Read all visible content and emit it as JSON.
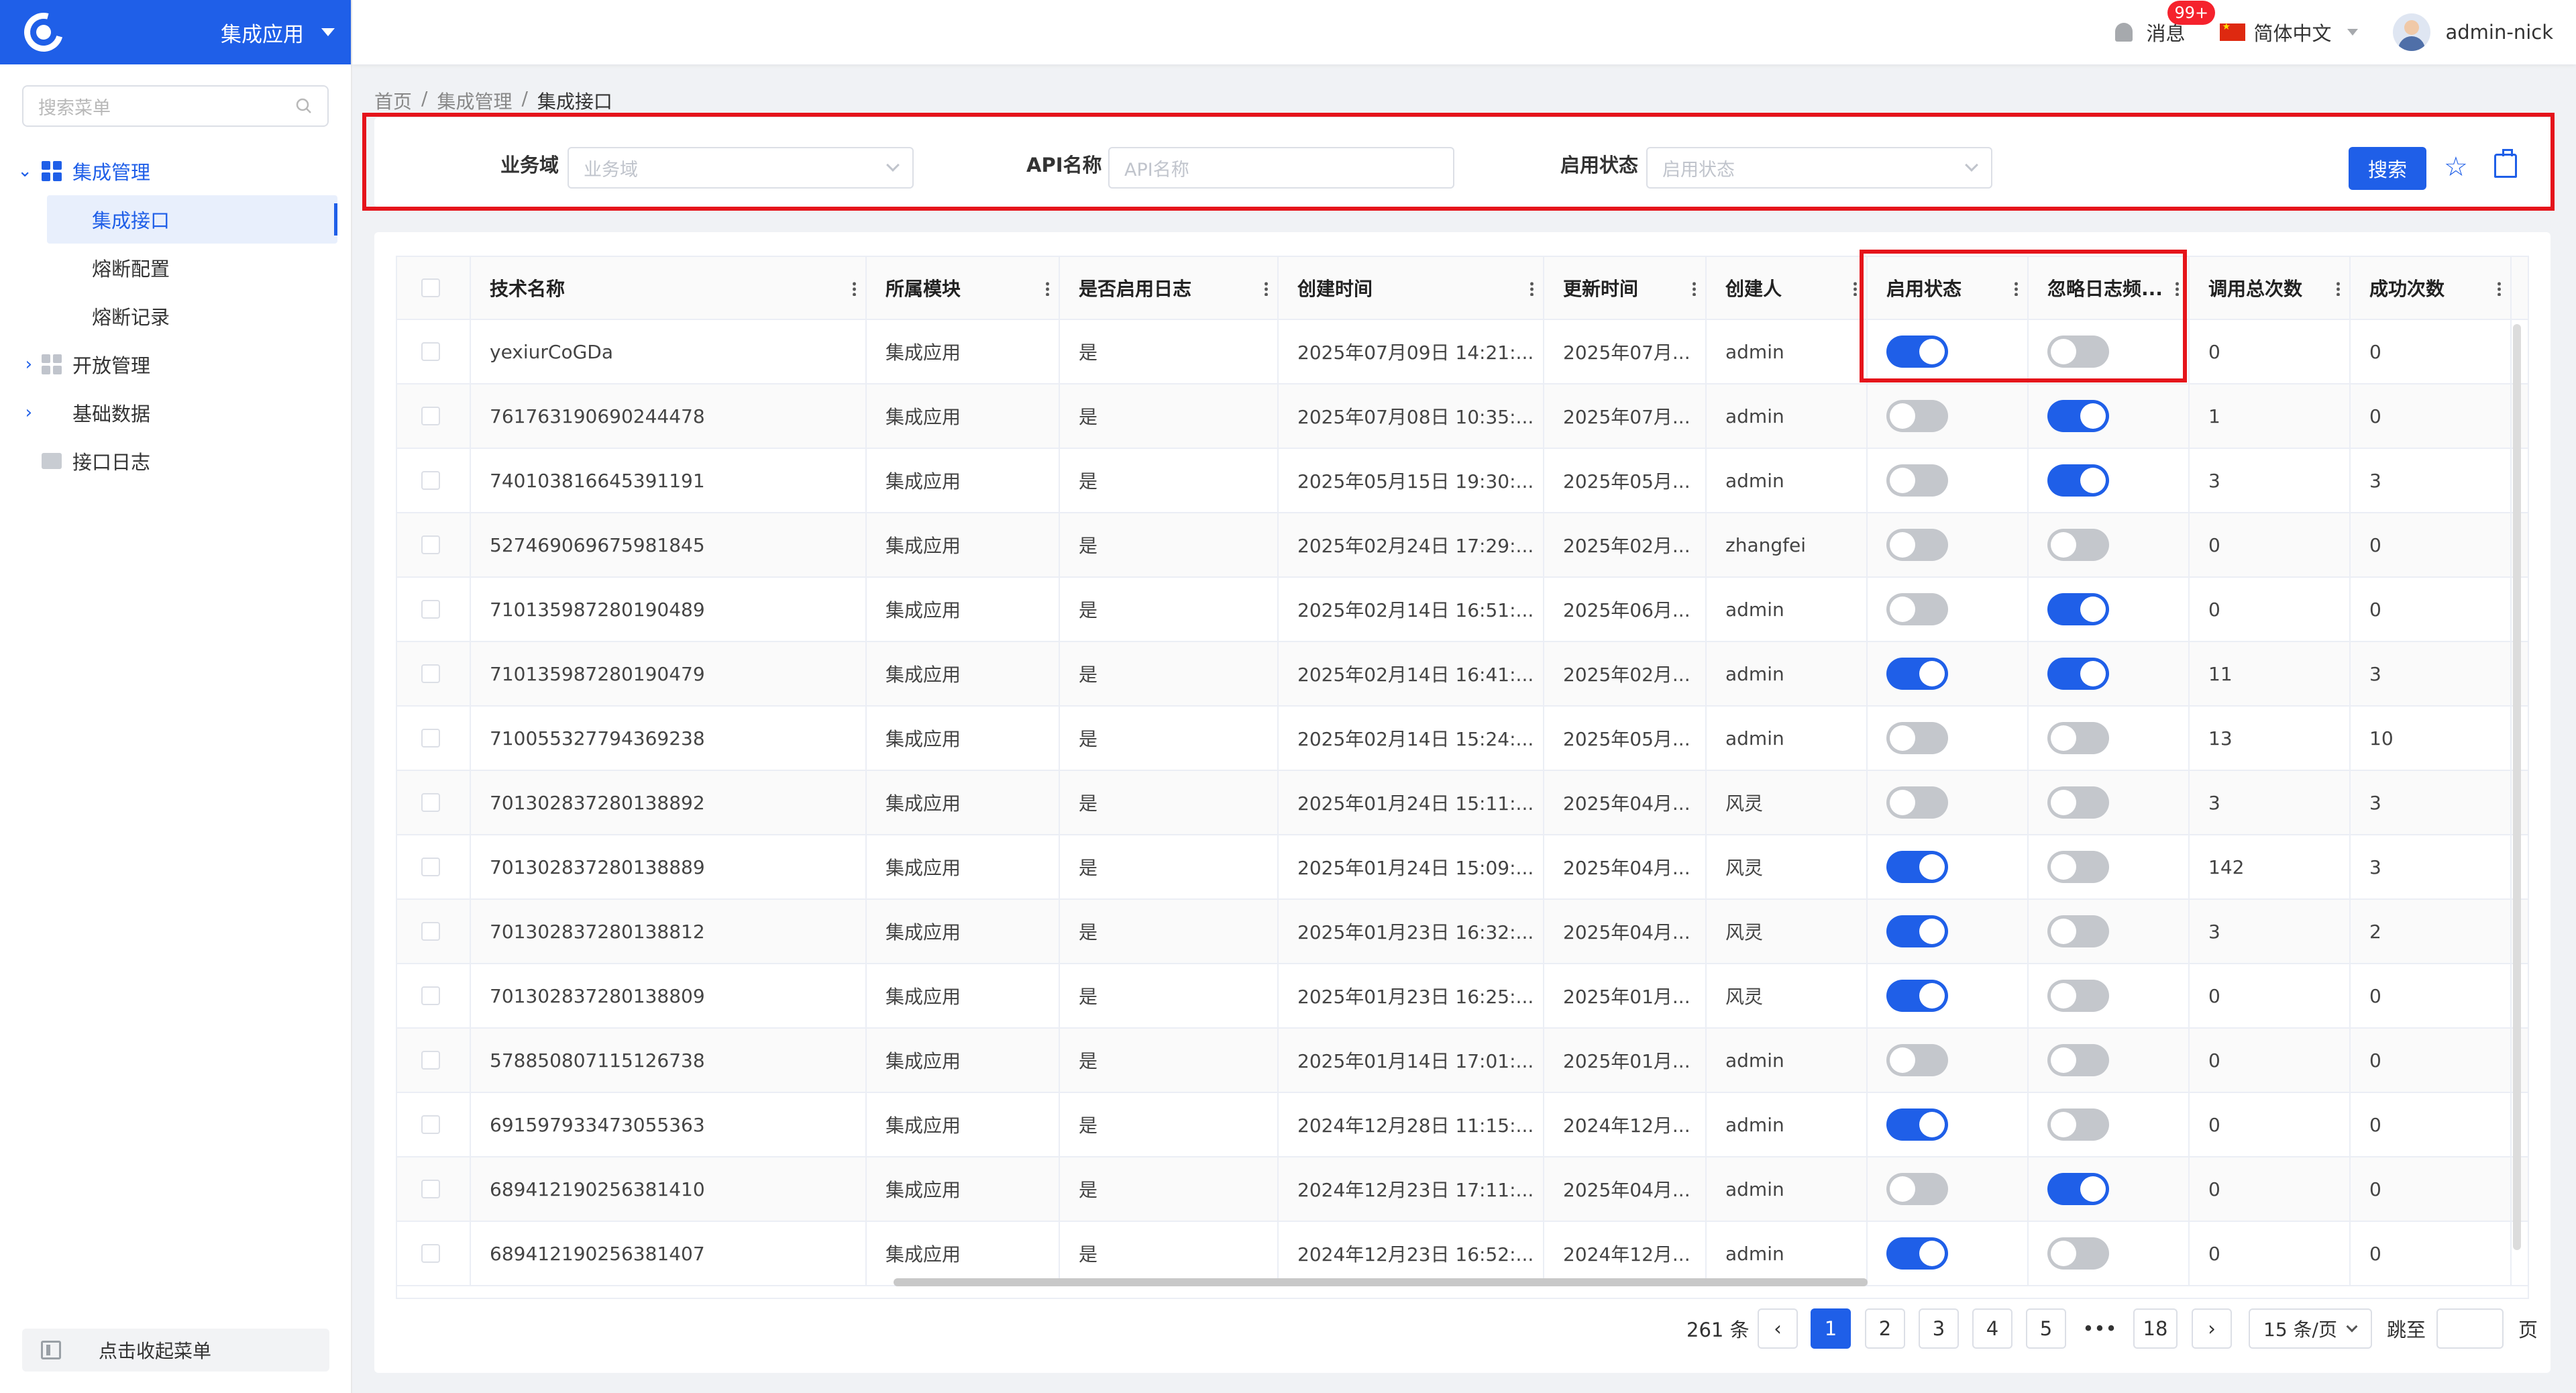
{
  "app": {
    "title": "集成应用"
  },
  "sidebar": {
    "search_placeholder": "搜索菜单",
    "items": [
      {
        "label": "集成管理",
        "expanded": true
      },
      {
        "label": "集成接口",
        "active": true
      },
      {
        "label": "熔断配置"
      },
      {
        "label": "熔断记录"
      },
      {
        "label": "开放管理",
        "expanded": false
      },
      {
        "label": "基础数据",
        "expanded": false
      },
      {
        "label": "接口日志"
      }
    ],
    "collapse_label": "点击收起菜单"
  },
  "header": {
    "notifications_label": "消息",
    "notifications_badge": "99+",
    "language": "简体中文",
    "username": "admin-nick"
  },
  "breadcrumb": [
    "首页",
    "集成管理",
    "集成接口"
  ],
  "filters": {
    "domain_label": "业务域",
    "domain_placeholder": "业务域",
    "api_label": "API名称",
    "api_placeholder": "API名称",
    "status_label": "启用状态",
    "status_placeholder": "启用状态",
    "search_button": "搜索"
  },
  "table": {
    "columns": [
      "技术名称",
      "所属模块",
      "是否启用日志",
      "创建时间",
      "更新时间",
      "创建人",
      "启用状态",
      "忽略日志频...",
      "调用总次数",
      "成功次数"
    ],
    "rows": [
      {
        "name": "yexiurCoGDa",
        "module": "集成应用",
        "log": "是",
        "created": "2025年07月09日 14:21:...",
        "updated": "2025年07月...",
        "creator": "admin",
        "enabled": true,
        "ignore_log": false,
        "calls": "0",
        "success": "0"
      },
      {
        "name": "761763190690244478",
        "module": "集成应用",
        "log": "是",
        "created": "2025年07月08日 10:35:...",
        "updated": "2025年07月...",
        "creator": "admin",
        "enabled": false,
        "ignore_log": true,
        "calls": "1",
        "success": "0"
      },
      {
        "name": "740103816645391191",
        "module": "集成应用",
        "log": "是",
        "created": "2025年05月15日 19:30:...",
        "updated": "2025年05月...",
        "creator": "admin",
        "enabled": false,
        "ignore_log": true,
        "calls": "3",
        "success": "3"
      },
      {
        "name": "527469069675981845",
        "module": "集成应用",
        "log": "是",
        "created": "2025年02月24日 17:29:...",
        "updated": "2025年02月...",
        "creator": "zhangfei",
        "enabled": false,
        "ignore_log": false,
        "calls": "0",
        "success": "0"
      },
      {
        "name": "710135987280190489",
        "module": "集成应用",
        "log": "是",
        "created": "2025年02月14日 16:51:...",
        "updated": "2025年06月...",
        "creator": "admin",
        "enabled": false,
        "ignore_log": true,
        "calls": "0",
        "success": "0"
      },
      {
        "name": "710135987280190479",
        "module": "集成应用",
        "log": "是",
        "created": "2025年02月14日 16:41:...",
        "updated": "2025年02月...",
        "creator": "admin",
        "enabled": true,
        "ignore_log": true,
        "calls": "11",
        "success": "3"
      },
      {
        "name": "710055327794369238",
        "module": "集成应用",
        "log": "是",
        "created": "2025年02月14日 15:24:...",
        "updated": "2025年05月...",
        "creator": "admin",
        "enabled": false,
        "ignore_log": false,
        "calls": "13",
        "success": "10"
      },
      {
        "name": "701302837280138892",
        "module": "集成应用",
        "log": "是",
        "created": "2025年01月24日 15:11:...",
        "updated": "2025年04月...",
        "creator": "风灵",
        "enabled": false,
        "ignore_log": false,
        "calls": "3",
        "success": "3"
      },
      {
        "name": "701302837280138889",
        "module": "集成应用",
        "log": "是",
        "created": "2025年01月24日 15:09:...",
        "updated": "2025年04月...",
        "creator": "风灵",
        "enabled": true,
        "ignore_log": false,
        "calls": "142",
        "success": "3"
      },
      {
        "name": "701302837280138812",
        "module": "集成应用",
        "log": "是",
        "created": "2025年01月23日 16:32:...",
        "updated": "2025年04月...",
        "creator": "风灵",
        "enabled": true,
        "ignore_log": false,
        "calls": "3",
        "success": "2"
      },
      {
        "name": "701302837280138809",
        "module": "集成应用",
        "log": "是",
        "created": "2025年01月23日 16:25:...",
        "updated": "2025年01月...",
        "creator": "风灵",
        "enabled": true,
        "ignore_log": false,
        "calls": "0",
        "success": "0"
      },
      {
        "name": "578850807115126738",
        "module": "集成应用",
        "log": "是",
        "created": "2025年01月14日 17:01:...",
        "updated": "2025年01月...",
        "creator": "admin",
        "enabled": false,
        "ignore_log": false,
        "calls": "0",
        "success": "0"
      },
      {
        "name": "691597933473055363",
        "module": "集成应用",
        "log": "是",
        "created": "2024年12月28日 11:15:...",
        "updated": "2024年12月...",
        "creator": "admin",
        "enabled": true,
        "ignore_log": false,
        "calls": "0",
        "success": "0"
      },
      {
        "name": "689412190256381410",
        "module": "集成应用",
        "log": "是",
        "created": "2024年12月23日 17:11:...",
        "updated": "2025年04月...",
        "creator": "admin",
        "enabled": false,
        "ignore_log": true,
        "calls": "0",
        "success": "0"
      },
      {
        "name": "689412190256381407",
        "module": "集成应用",
        "log": "是",
        "created": "2024年12月23日 16:52:...",
        "updated": "2024年12月...",
        "creator": "admin",
        "enabled": true,
        "ignore_log": false,
        "calls": "0",
        "success": "0"
      }
    ]
  },
  "pagination": {
    "total": "261 条",
    "pages": [
      "1",
      "2",
      "3",
      "4",
      "5",
      "•••",
      "18"
    ],
    "current": "1",
    "page_size": "15 条/页",
    "jump_label": "跳至",
    "page_suffix": "页"
  },
  "colors": {
    "primary": "#1f5fe8",
    "highlight": "#e5141b",
    "switch_off": "#c4c7cc"
  }
}
